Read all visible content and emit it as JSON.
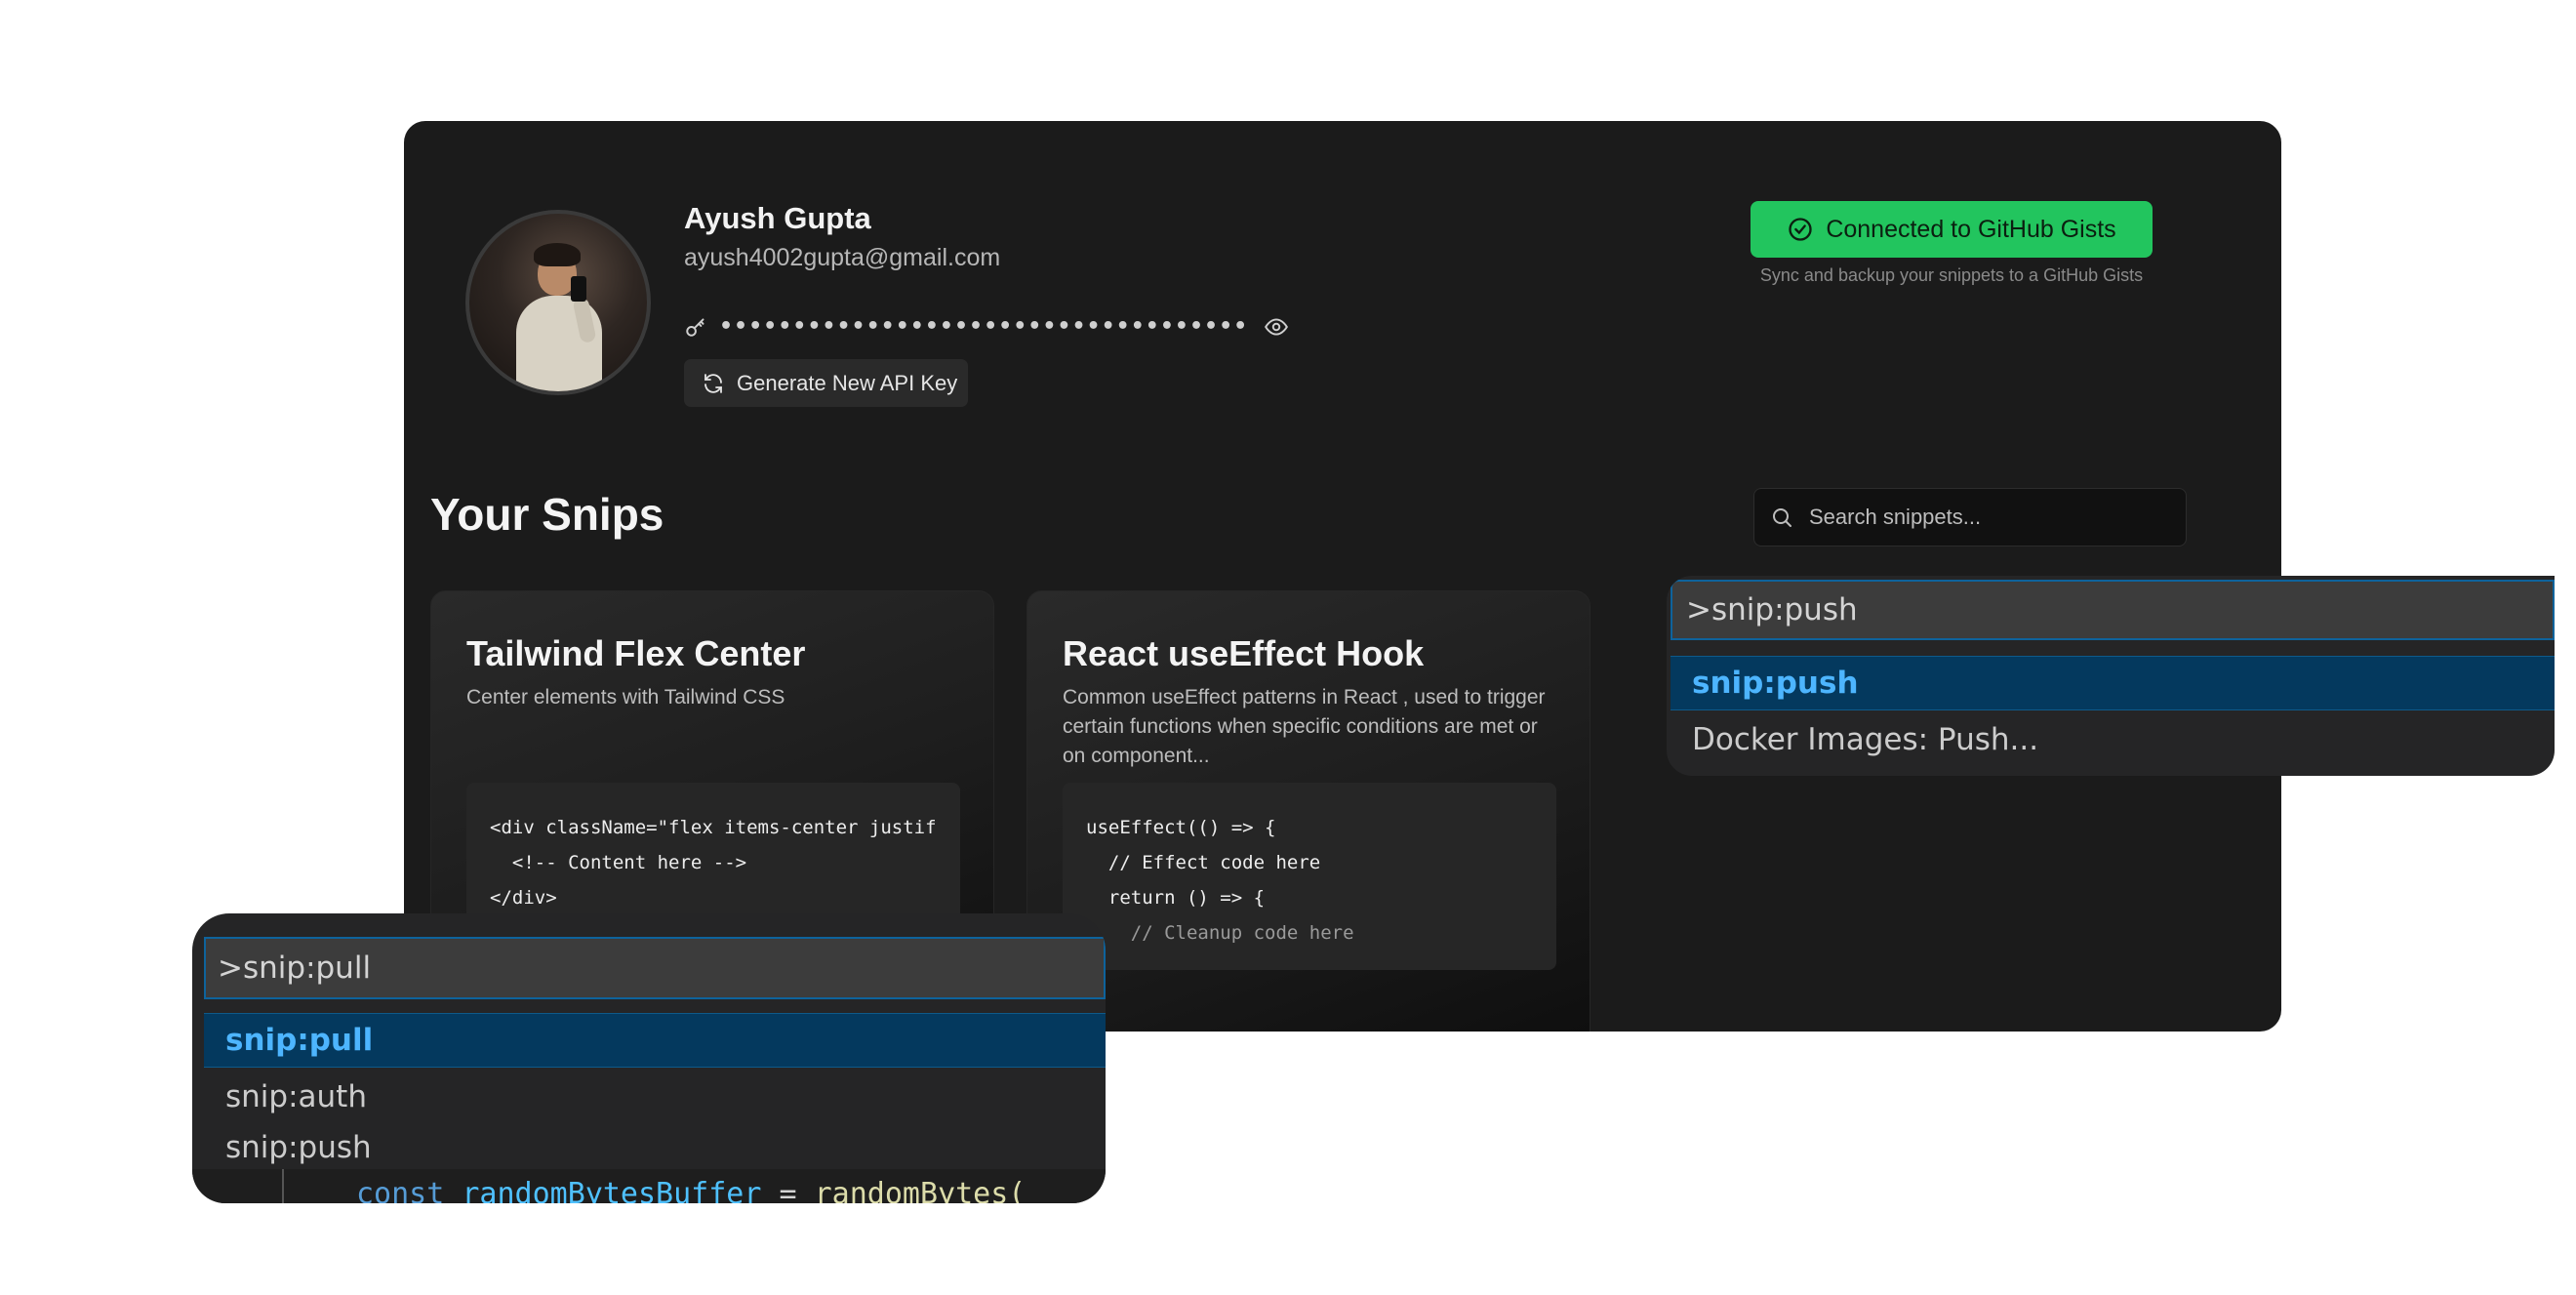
{
  "profile": {
    "name": "Ayush Gupta",
    "email": "ayush4002gupta@gmail.com",
    "api_key_masked": "••••••••••••••••••••••••••••••••••••",
    "generate_key_label": "Generate New API Key"
  },
  "github": {
    "button_label": "Connected to GitHub Gists",
    "subtitle": "Sync and backup your snippets to a GitHub Gists",
    "accent_color": "#22c55e"
  },
  "snips": {
    "section_title": "Your Snips",
    "search_placeholder": "Search snippets...",
    "cards": [
      {
        "title": "Tailwind Flex Center",
        "description": "Center elements with Tailwind CSS",
        "code": [
          "<div className=\"flex items-center justif",
          "  <!-- Content here -->",
          "</div>"
        ]
      },
      {
        "title": "React useEffect Hook",
        "description": "Common useEffect patterns in React , used to trigger certain functions when specific conditions are met or on component...",
        "code": [
          "useEffect(() => {",
          "  // Effect code here",
          "  return () => {",
          "    // Cleanup code here"
        ]
      }
    ]
  },
  "palette_push": {
    "input_value": ">snip:push",
    "items": [
      {
        "label": "snip:push",
        "active": true
      },
      {
        "label": "Docker Images: Push...",
        "active": false
      }
    ]
  },
  "palette_pull": {
    "input_value": ">snip:pull",
    "items": [
      {
        "label": "snip:pull",
        "active": true
      },
      {
        "label": "snip:auth",
        "active": false
      },
      {
        "label": "snip:push",
        "active": false
      }
    ],
    "code_keyword": "const",
    "code_var": "randomBytesBuffer",
    "code_op": " = ",
    "code_fn": "randomBytes("
  },
  "colors": {
    "background": "#ffffff",
    "app_background": "#1b1b1b",
    "palette_active_bg": "#04395e",
    "palette_active_text": "#4db5ff"
  }
}
